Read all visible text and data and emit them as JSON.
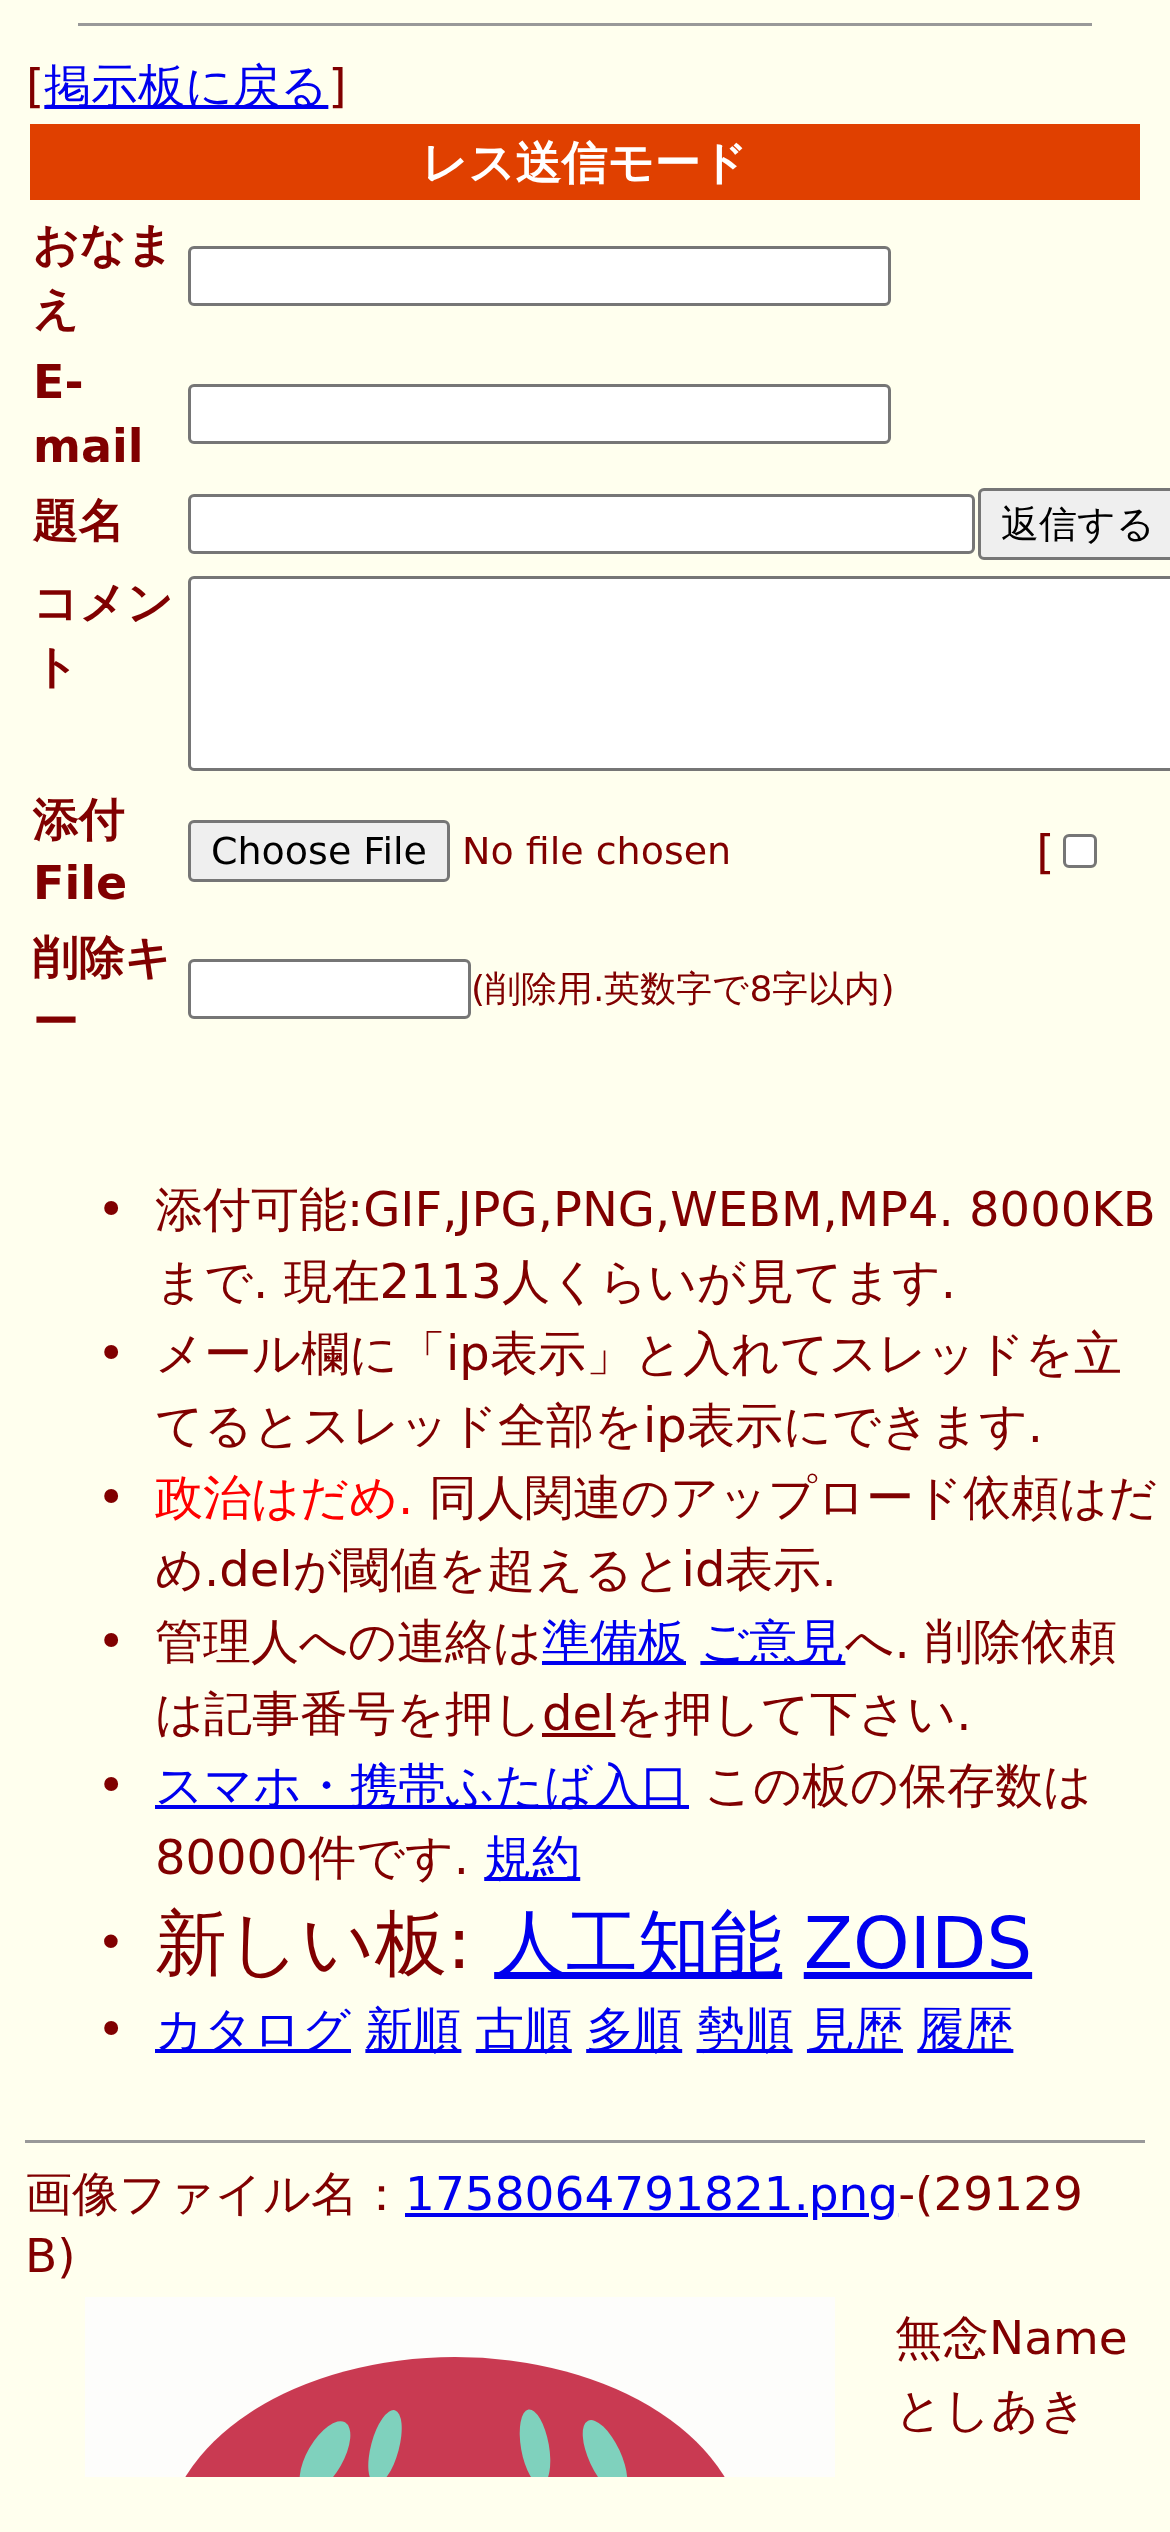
{
  "back_link": {
    "open": "[",
    "label": "掲示板に戻る",
    "close": "]"
  },
  "form": {
    "title": "レス送信モード",
    "fields": [
      {
        "kind": "text",
        "label": "おなまえ"
      },
      {
        "kind": "text",
        "label": "E-mail"
      },
      {
        "kind": "text_button",
        "label": "題名",
        "button": "返信する"
      },
      {
        "kind": "textarea",
        "label": "コメント"
      },
      {
        "kind": "file",
        "label": "添付File",
        "button": "Choose File",
        "status": "No file chosen",
        "bracket": "[",
        "checked": false
      },
      {
        "kind": "key",
        "label": "削除キー",
        "note": "(削除用.英数字で8字以内)"
      }
    ]
  },
  "notices": [
    {
      "kind": "normal",
      "marker": "•",
      "parts": [
        {
          "kind": "text",
          "text": "添付可能:GIF,JPG,PNG,WEBM,MP4. 8000KBまで. 現在2113人くらいが見てます."
        }
      ]
    },
    {
      "kind": "normal",
      "marker": "•",
      "parts": [
        {
          "kind": "text",
          "text": "メール欄に「ip表示」と入れてスレッドを立てるとスレッド全部をip表示にできます."
        }
      ]
    },
    {
      "kind": "normal",
      "marker": "•",
      "parts": [
        {
          "kind": "alert",
          "text": "政治はだめ."
        },
        {
          "kind": "text",
          "text": " 同人関連のアップロード依頼はだめ.delが閾値を超えるとid表示."
        }
      ]
    },
    {
      "kind": "normal",
      "marker": "•",
      "parts": [
        {
          "kind": "text",
          "text": "管理人への連絡は"
        },
        {
          "kind": "link",
          "text": "準備板"
        },
        {
          "kind": "link",
          "text": "ご意見"
        },
        {
          "kind": "text",
          "text": "へ. 削除依頼は記事番号を押し"
        },
        {
          "kind": "dark_link",
          "text": "del"
        },
        {
          "kind": "text",
          "text": "を押して下さい."
        }
      ]
    },
    {
      "kind": "normal",
      "marker": "•",
      "parts": [
        {
          "kind": "link",
          "text": "スマホ・携帯ふたば入口"
        },
        {
          "kind": "text",
          "text": " この板の保存数は80000件です. "
        },
        {
          "kind": "link",
          "text": "規約"
        }
      ]
    },
    {
      "kind": "large",
      "marker": "•",
      "parts": [
        {
          "kind": "text",
          "text": "新しい板: "
        },
        {
          "kind": "link",
          "text": "人工知能"
        },
        {
          "kind": "link",
          "text": "ZOIDS"
        }
      ]
    },
    {
      "kind": "normal",
      "marker": "•",
      "parts": [
        {
          "kind": "link",
          "text": "カタログ"
        },
        {
          "kind": "link",
          "text": "新順"
        },
        {
          "kind": "link",
          "text": "古順"
        },
        {
          "kind": "link",
          "text": "多順"
        },
        {
          "kind": "link",
          "text": "勢順"
        },
        {
          "kind": "link",
          "text": "見歴"
        },
        {
          "kind": "link",
          "text": "履歴"
        }
      ]
    }
  ],
  "post": {
    "file_label": "画像ファイル名：",
    "file_link": "1758064791821.png",
    "file_size": "-(29129 B)",
    "subject": "無念",
    "name_label": "Name",
    "name": "としあき"
  }
}
